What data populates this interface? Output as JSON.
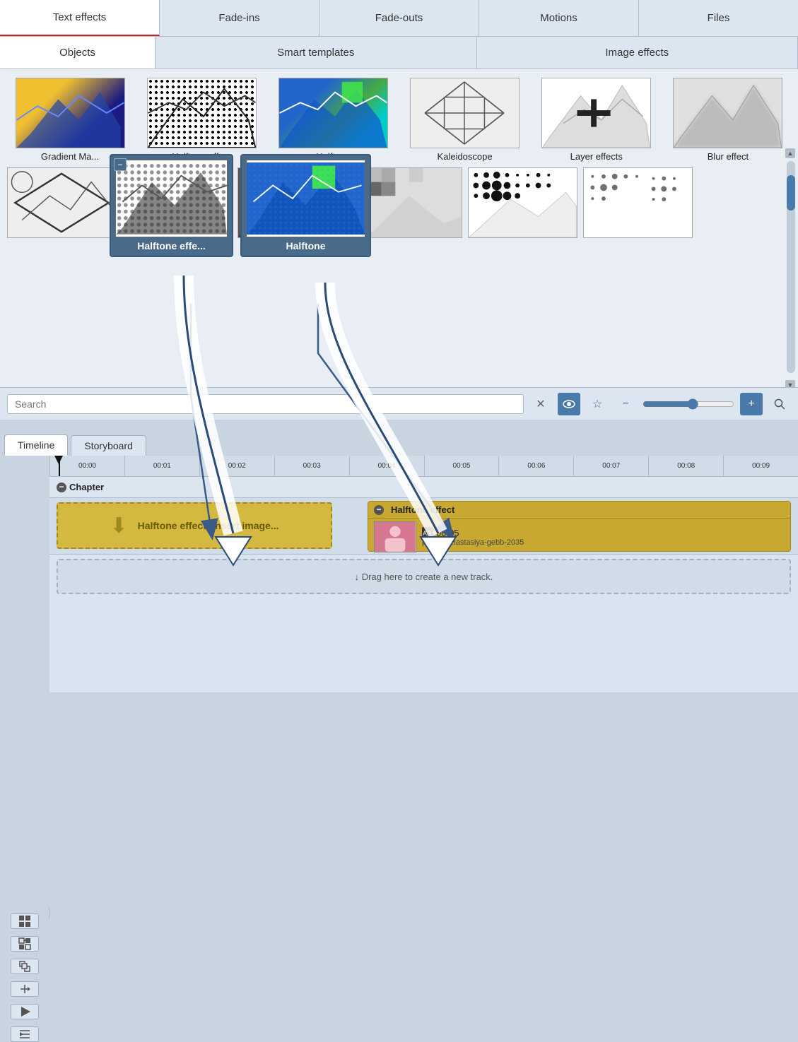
{
  "tabs_top": {
    "items": [
      {
        "id": "text-effects",
        "label": "Text effects",
        "active": true
      },
      {
        "id": "fade-ins",
        "label": "Fade-ins",
        "active": false
      },
      {
        "id": "fade-outs",
        "label": "Fade-outs",
        "active": false
      },
      {
        "id": "motions",
        "label": "Motions",
        "active": false
      },
      {
        "id": "files",
        "label": "Files",
        "active": false
      }
    ]
  },
  "tabs_second": {
    "items": [
      {
        "id": "objects",
        "label": "Objects",
        "active": true
      },
      {
        "id": "smart-templates",
        "label": "Smart templates",
        "active": false
      },
      {
        "id": "image-effects",
        "label": "Image effects",
        "active": false
      }
    ]
  },
  "effects": {
    "row1": [
      {
        "id": "gradient-map",
        "label": "Gradient Ma..."
      },
      {
        "id": "halftone-bw",
        "label": "Halftone effe...",
        "tooltip": true,
        "tooltip_label": "Halftone effe..."
      },
      {
        "id": "halftone-color",
        "label": "Halftone",
        "tooltip": true,
        "tooltip_label": "Halftone"
      },
      {
        "id": "kaleidoscope",
        "label": "Kaleidoscope"
      },
      {
        "id": "layer-effects",
        "label": "Layer effects"
      },
      {
        "id": "blur-effect",
        "label": "Blur effect"
      }
    ],
    "row2": [
      {
        "id": "diamond",
        "label": ""
      },
      {
        "id": "mountains-bw",
        "label": ""
      },
      {
        "id": "mountains-dark",
        "label": ""
      },
      {
        "id": "pixelate-color",
        "label": ""
      },
      {
        "id": "dots-pattern",
        "label": ""
      },
      {
        "id": "dots-pattern2",
        "label": ""
      }
    ]
  },
  "search": {
    "placeholder": "Search",
    "value": ""
  },
  "toolbar": {
    "close_label": "✕",
    "eye_label": "👁",
    "star_label": "☆",
    "minus_label": "−",
    "plus_label": "+",
    "search_label": "🔍"
  },
  "timeline": {
    "tab_timeline": "Timeline",
    "tab_storyboard": "Storyboard",
    "ruler_marks": [
      "00:00",
      "00:01",
      "00:02",
      "00:03",
      "00:04",
      "00:05",
      "00:06",
      "00:07",
      "00:08",
      "00:09"
    ],
    "chapter_label": "Chapter",
    "insert_label": "Halftone effect: Insert image...",
    "effect_header": "Halftone effect",
    "effect_time": "00:05",
    "effect_filename": "pexels-anastasiya-gebb-2035",
    "new_track_label": "↓ Drag here to create a new track."
  }
}
